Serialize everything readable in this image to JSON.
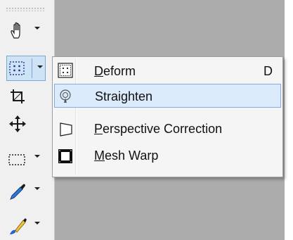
{
  "toolbar": {
    "tools": [
      {
        "icon": "hand-icon",
        "has_menu": true
      },
      {
        "icon": "deform-grid-icon",
        "has_menu": true,
        "active": true
      },
      {
        "icon": "crop-icon",
        "has_menu": false
      },
      {
        "icon": "move-icon",
        "has_menu": false
      },
      {
        "icon": "marquee-selection-icon",
        "has_menu": true
      },
      {
        "icon": "eyedropper-icon",
        "has_menu": true
      },
      {
        "icon": "paintbrush-icon",
        "has_menu": true
      }
    ]
  },
  "menu": {
    "items": [
      {
        "label_first": "D",
        "label_rest": "eform",
        "shortcut": "D",
        "icon": "deform-icon"
      },
      {
        "label_first": "",
        "label_rest": "Straighten",
        "shortcut": "",
        "icon": "straighten-icon",
        "highlighted": true
      },
      {
        "label_first": "P",
        "label_rest": "erspective Correction",
        "shortcut": "",
        "icon": "perspective-correction-icon"
      },
      {
        "label_first": "M",
        "label_rest": "esh Warp",
        "shortcut": "",
        "icon": "mesh-warp-icon"
      }
    ]
  },
  "colors": {
    "canvas": "#acacac",
    "toolbar_bg": "#f0f0f0",
    "menu_bg": "#f5f5f5",
    "highlight_bg": "#dcebfc",
    "highlight_border": "#84ace0"
  }
}
